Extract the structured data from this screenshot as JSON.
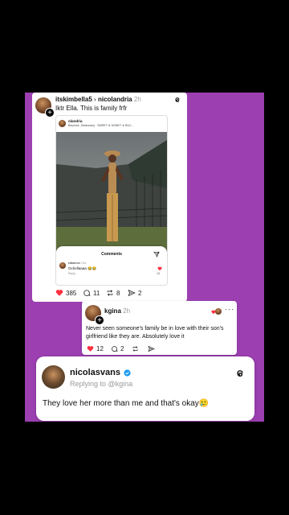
{
  "card1": {
    "username": "itskimbella5",
    "reply_to": "nicolandria",
    "time": "2h",
    "text": "Iktr Ella. This is family frfr",
    "likes": "385",
    "comments": "11",
    "reposts": "8",
    "shares": "2"
  },
  "embedded_post": {
    "username": "olandria",
    "song": "Beyoncé, Shaboozey · SWEET ★ HONEY ★ BUC...",
    "comments_title": "Comments",
    "comment_user": "ellasevon",
    "comment_time": "10w",
    "comment_text": "Ochellaaaa 😂😂",
    "comment_reply": "Reply",
    "comment_likes": "18"
  },
  "card2": {
    "username": "kgina",
    "time": "2h",
    "text": "Never seen someone's family be in love with their son's girlfriend like they are. Absolutely love it",
    "likes": "12",
    "comments": "2"
  },
  "card3": {
    "username": "nicolasvans",
    "replying": "Replying to @kgina",
    "text": "They love her more than me and that's okay🥲"
  },
  "colors": {
    "background": "#000000",
    "panel": "#9b3fb1",
    "like_red": "#ff3040",
    "verified": "#1d9bf0"
  }
}
